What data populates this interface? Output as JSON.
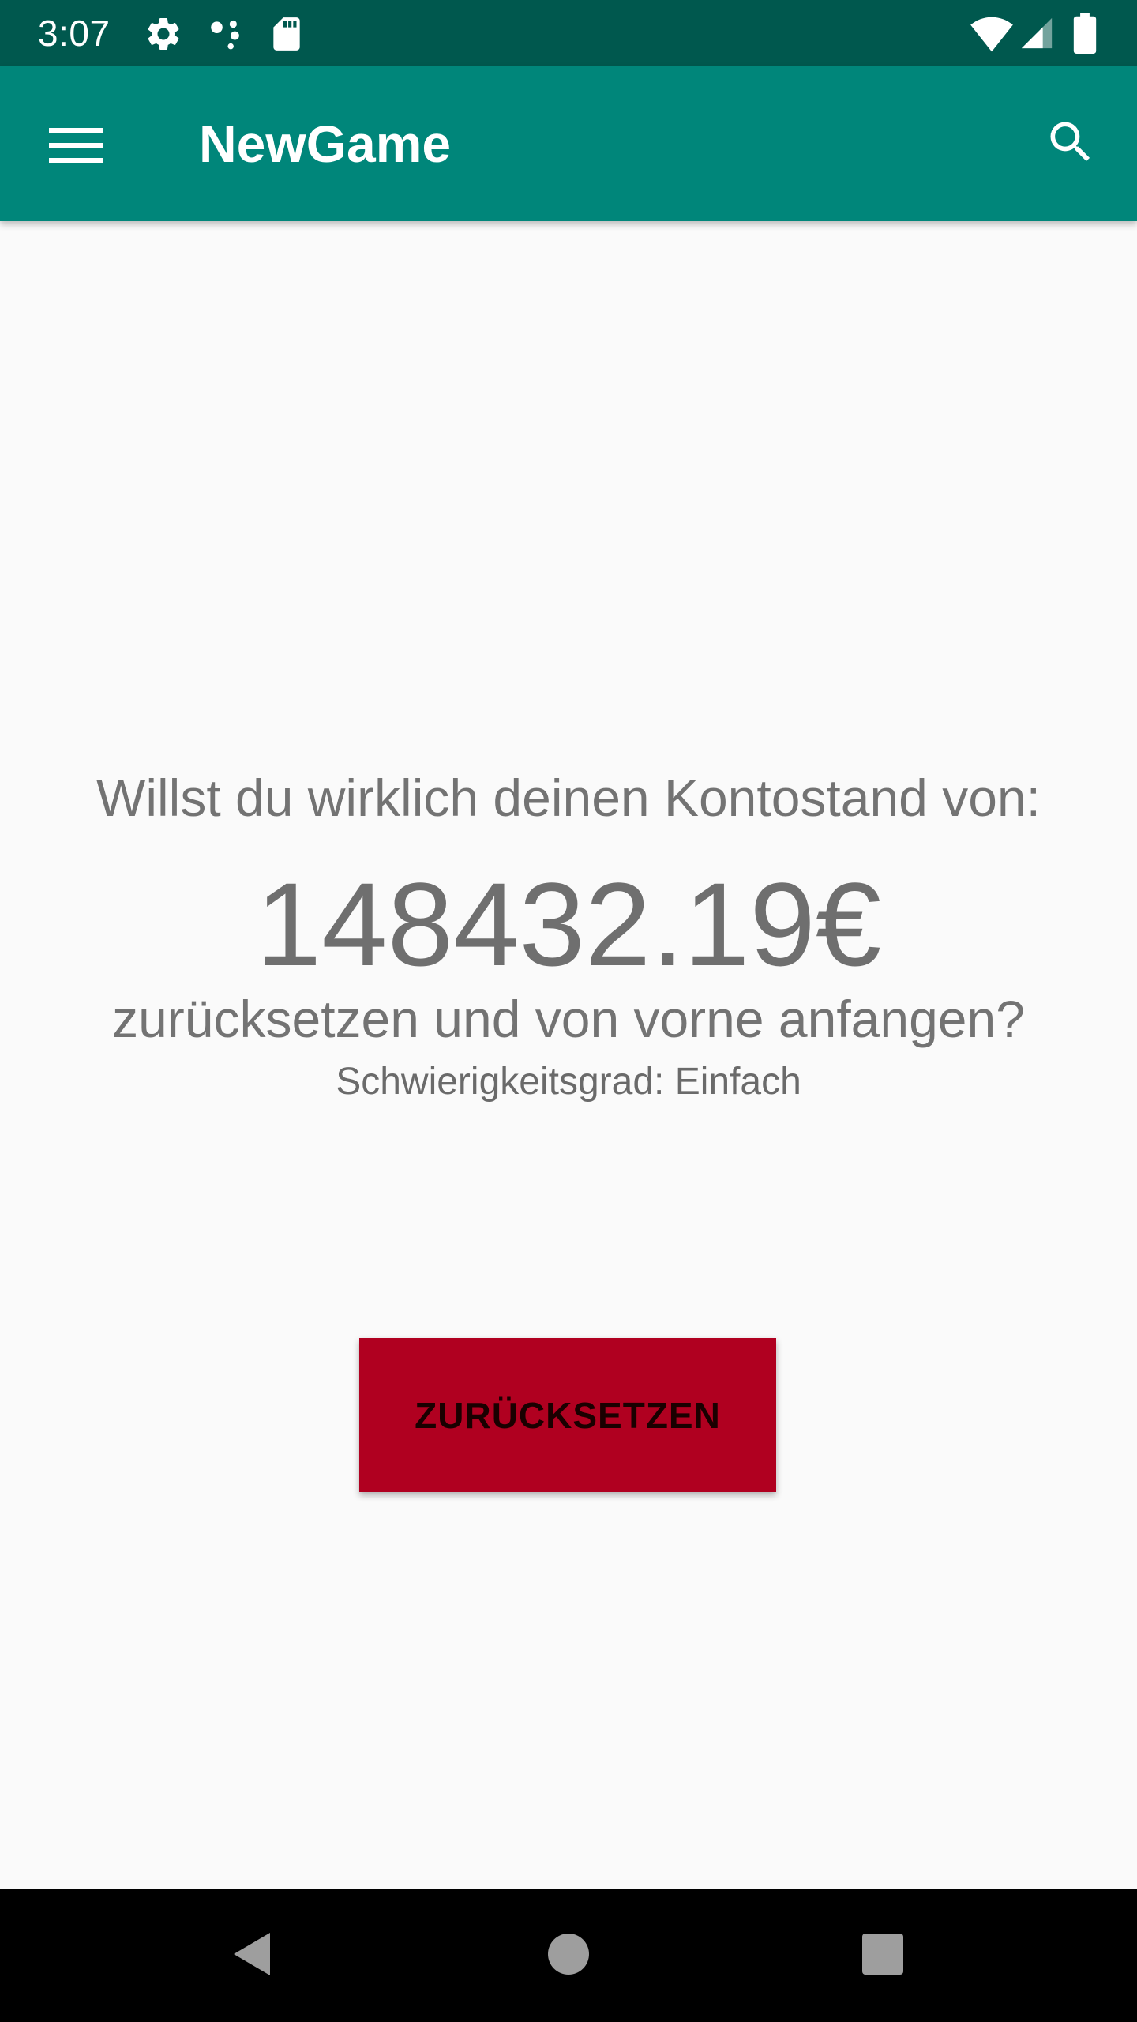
{
  "status_bar": {
    "time": "3:07",
    "icons": [
      "settings-icon",
      "assistant-dots-icon",
      "sd-card-icon",
      "wifi-icon",
      "signal-icon",
      "battery-icon"
    ],
    "color": "#00584e"
  },
  "app_bar": {
    "title": "NewGame",
    "color": "#00867a",
    "menu_icon": "hamburger-menu-icon",
    "search_icon": "search-icon"
  },
  "main": {
    "prompt_top": "Willst du wirklich deinen Kontostand von:",
    "balance": "148432.19€",
    "prompt_bottom": "zurücksetzen und von vorne anfangen?",
    "difficulty": "Schwierigkeitsgrad: Einfach",
    "reset_button_label": "ZURÜCKSETZEN",
    "reset_button_color": "#b00020"
  },
  "nav_bar": {
    "buttons": [
      "back-icon",
      "home-icon",
      "recents-icon"
    ]
  }
}
